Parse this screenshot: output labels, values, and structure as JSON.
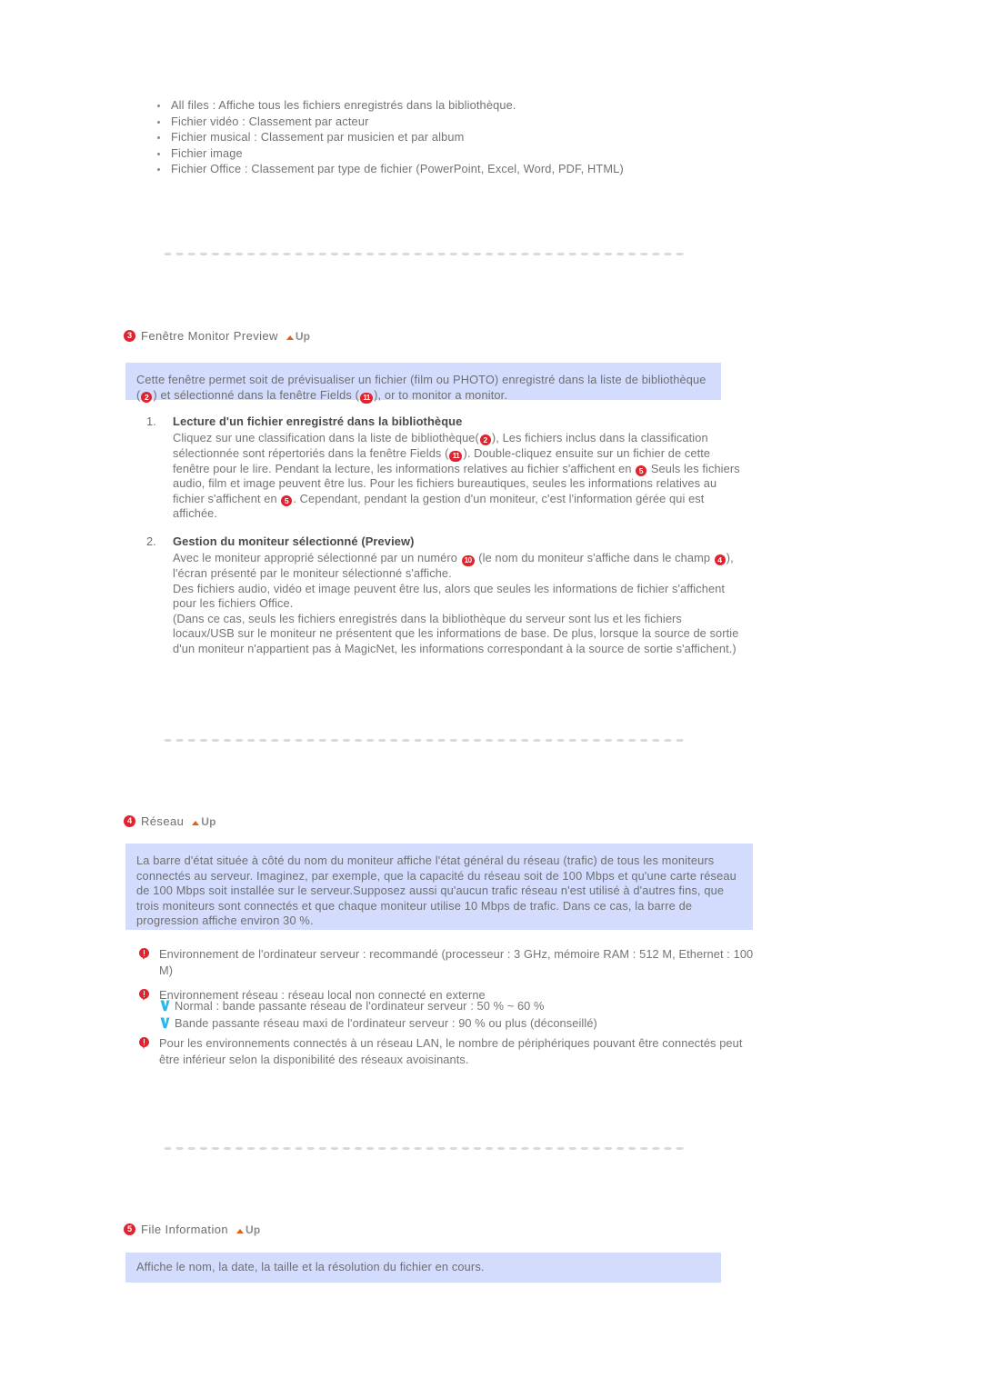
{
  "top_list": {
    "items": [
      "All files : Affiche tous les fichiers enregistrés dans la bibliothèque.",
      "Fichier vidéo : Classement par acteur",
      "Fichier musical : Classement par musicien et par album",
      "Fichier image",
      "Fichier Office : Classement par type de fichier (PowerPoint, Excel, Word, PDF, HTML)"
    ]
  },
  "up_label": "Up",
  "section_monitor_preview": {
    "number": "3",
    "title": "Fenêtre Monitor Preview",
    "intro_parts": {
      "p1": "Cette fenêtre permet soit de prévisualiser un fichier (film ou PHOTO) enregistré dans la liste de bibliothèque (",
      "badge1": "2",
      "p2": ") et sélectionné dans la fenêtre Fields (",
      "badge2": "11",
      "p3": "), or to monitor a monitor."
    },
    "items": [
      {
        "marker": "1.",
        "title": "Lecture d'un fichier enregistré dans la bibliothèque",
        "body": {
          "a": "Cliquez sur une classification dans la liste de bibliothèque(",
          "badge_a": "2",
          "b": "), Les fichiers inclus dans la classification sélectionnée sont répertoriés dans la fenêtre Fields (",
          "badge_b": "11",
          "c": "). Double-cliquez ensuite sur un fichier de cette fenêtre pour le lire. Pendant la lecture, les informations relatives au fichier s'affichent en ",
          "badge_c": "5",
          "d": " Seuls les fichiers audio, film et image peuvent être lus. Pour les fichiers bureautiques, seules les informations relatives au fichier s'affichent en ",
          "badge_d": "5",
          "e": ". Cependant, pendant la gestion d'un moniteur, c'est l'information gérée qui est affichée."
        }
      },
      {
        "marker": "2.",
        "title": "Gestion du moniteur sélectionné (Preview)",
        "body": {
          "a": "Avec le moniteur approprié sélectionné par un numéro ",
          "badge_a": "10",
          "b": " (le nom du moniteur s'affiche dans le champ ",
          "badge_b": "4",
          "c": "), l'écran présenté par le moniteur sélectionné s'affiche."
        },
        "para2": "Des fichiers audio, vidéo et image peuvent être lus, alors que seules les informations de fichier s'affichent pour les fichiers Office.",
        "para3": "(Dans ce cas, seuls les fichiers enregistrés dans la bibliothèque du serveur sont lus et les fichiers locaux/USB sur le moniteur ne présentent que les informations de base. De plus, lorsque la source de sortie d'un moniteur n'appartient pas à MagicNet, les informations correspondant à la source de sortie s'affichent.)"
      }
    ]
  },
  "section_reseau": {
    "number": "4",
    "title": "Réseau",
    "intro": "La barre d'état située à côté du nom du moniteur affiche l'état général du réseau (trafic) de tous les moniteurs connectés au serveur. Imaginez, par exemple, que la capacité du réseau soit de 100 Mbps et qu'une carte réseau de 100 Mbps soit installée sur le serveur.Supposez aussi qu'aucun trafic réseau n'est utilisé à d'autres fins, que trois moniteurs sont connectés et que chaque moniteur utilise 10 Mbps de trafic. Dans ce cas, la barre de progression affiche environ 30 %.",
    "notes": [
      "Environnement de l'ordinateur serveur : recommandé (processeur : 3 GHz, mémoire RAM : 512 M, Ethernet : 100 M)",
      "Environnement réseau : réseau local non connecté en externe"
    ],
    "sub_notes": [
      "Normal : bande passante réseau de l'ordinateur serveur : 50 % ~ 60 %",
      "Bande passante réseau maxi de l'ordinateur serveur : 90 % ou plus (déconseillé)"
    ],
    "note_last": "Pour les environnements connectés à un réseau LAN, le nombre de périphériques pouvant être connectés peut être inférieur selon la disponibilité des réseaux avoisinants."
  },
  "section_file_information": {
    "number": "5",
    "title": "File Information",
    "intro": "Affiche le nom, la date, la taille et la résolution du fichier en cours."
  },
  "colors": {
    "badge_red": "#e0232e",
    "box_blue": "#d3dcfc",
    "text_gray": "#747474",
    "up_orange": "#e1601b"
  }
}
